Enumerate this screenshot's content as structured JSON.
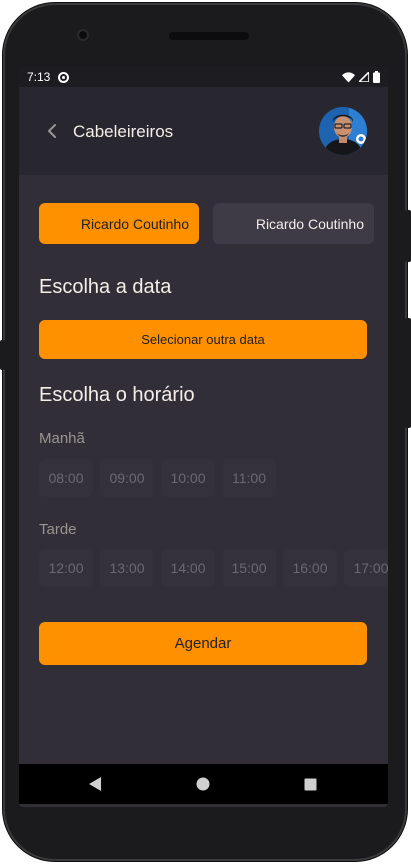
{
  "status_bar": {
    "time": "7:13"
  },
  "header": {
    "title": "Cabeleireiros"
  },
  "providers": [
    {
      "name": "Ricardo Coutinho",
      "selected": true
    },
    {
      "name": "Ricardo Coutinho",
      "selected": false
    }
  ],
  "date_section": {
    "title": "Escolha a data",
    "button_label": "Selecionar outra data"
  },
  "hour_section": {
    "title": "Escolha o horário",
    "morning": {
      "label": "Manhã",
      "hours": [
        "08:00",
        "09:00",
        "10:00",
        "11:00"
      ]
    },
    "afternoon": {
      "label": "Tarde",
      "hours": [
        "12:00",
        "13:00",
        "14:00",
        "15:00",
        "16:00",
        "17:00"
      ]
    }
  },
  "schedule_button": {
    "label": "Agendar"
  },
  "colors": {
    "accent": "#ff9000",
    "background": "#312e38",
    "header": "#28262e",
    "text": "#f4ede8",
    "muted": "#999591"
  }
}
